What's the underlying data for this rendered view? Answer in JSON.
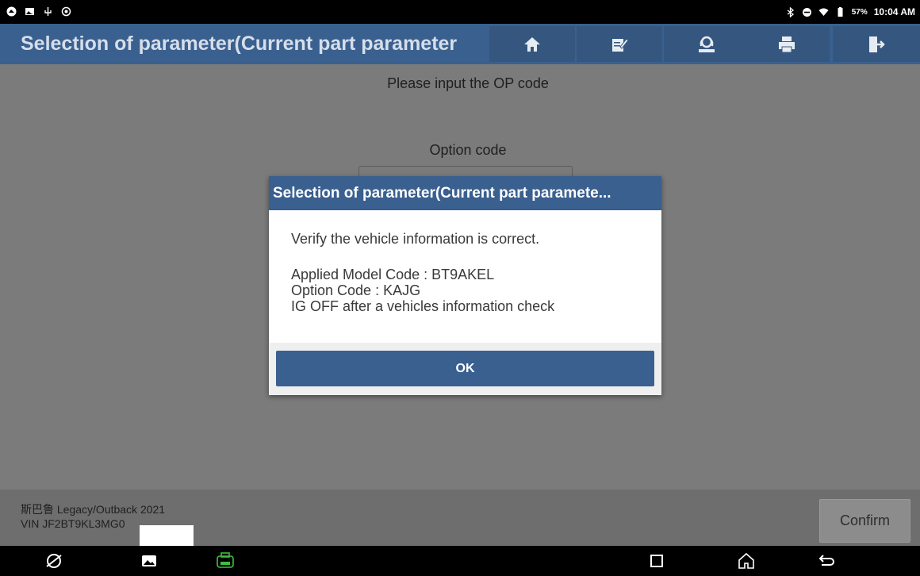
{
  "status_bar": {
    "battery": "57%",
    "time": "10:04 AM"
  },
  "header": {
    "title": "Selection of parameter(Current part parameter",
    "buttons": [
      "home-icon",
      "edit-icon",
      "support-icon",
      "print-icon",
      "exit-icon"
    ]
  },
  "main": {
    "prompt": "Please input the OP code",
    "option_label": "Option code"
  },
  "dialog": {
    "title": "Selection of parameter(Current part paramete...",
    "message": "Verify the vehicle information is correct.",
    "model_code": "Applied Model Code : BT9AKEL",
    "option_code": "Option Code : KAJG",
    "ig_note": "IG OFF after a vehicles information check",
    "ok_label": "OK"
  },
  "footer": {
    "vehicle": "斯巴鲁 Legacy/Outback 2021",
    "vin": "VIN JF2BT9KL3MG0",
    "confirm_label": "Confirm"
  },
  "colors": {
    "accent": "#3a608f",
    "background": "#7b7b7b"
  }
}
